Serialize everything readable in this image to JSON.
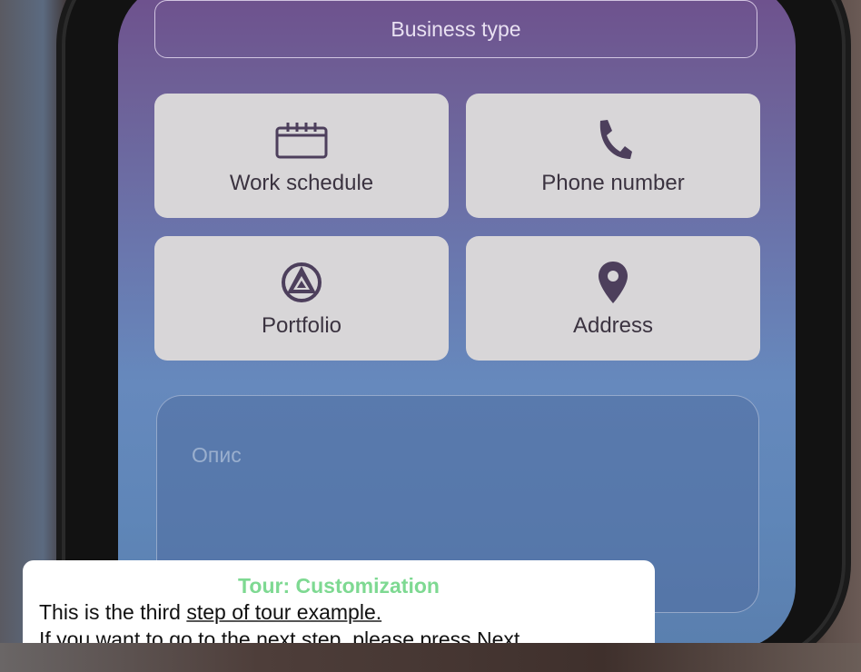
{
  "form": {
    "business_type_label": "Business type",
    "tiles": [
      {
        "label": "Work schedule",
        "icon": "calendar-icon"
      },
      {
        "label": "Phone number",
        "icon": "phone-icon"
      },
      {
        "label": "Portfolio",
        "icon": "portfolio-icon"
      },
      {
        "label": "Address",
        "icon": "location-pin-icon"
      }
    ],
    "description_placeholder": "Опис"
  },
  "tour": {
    "title": "Tour: Customization",
    "line1_prefix": "This is the third ",
    "line1_link": "step of tour example.",
    "line2": "If you want to go to the next step, please press Next"
  },
  "colors": {
    "tile_bg": "#d8d6d8",
    "icon": "#4d3f5c",
    "tour_title": "#7ed992"
  }
}
